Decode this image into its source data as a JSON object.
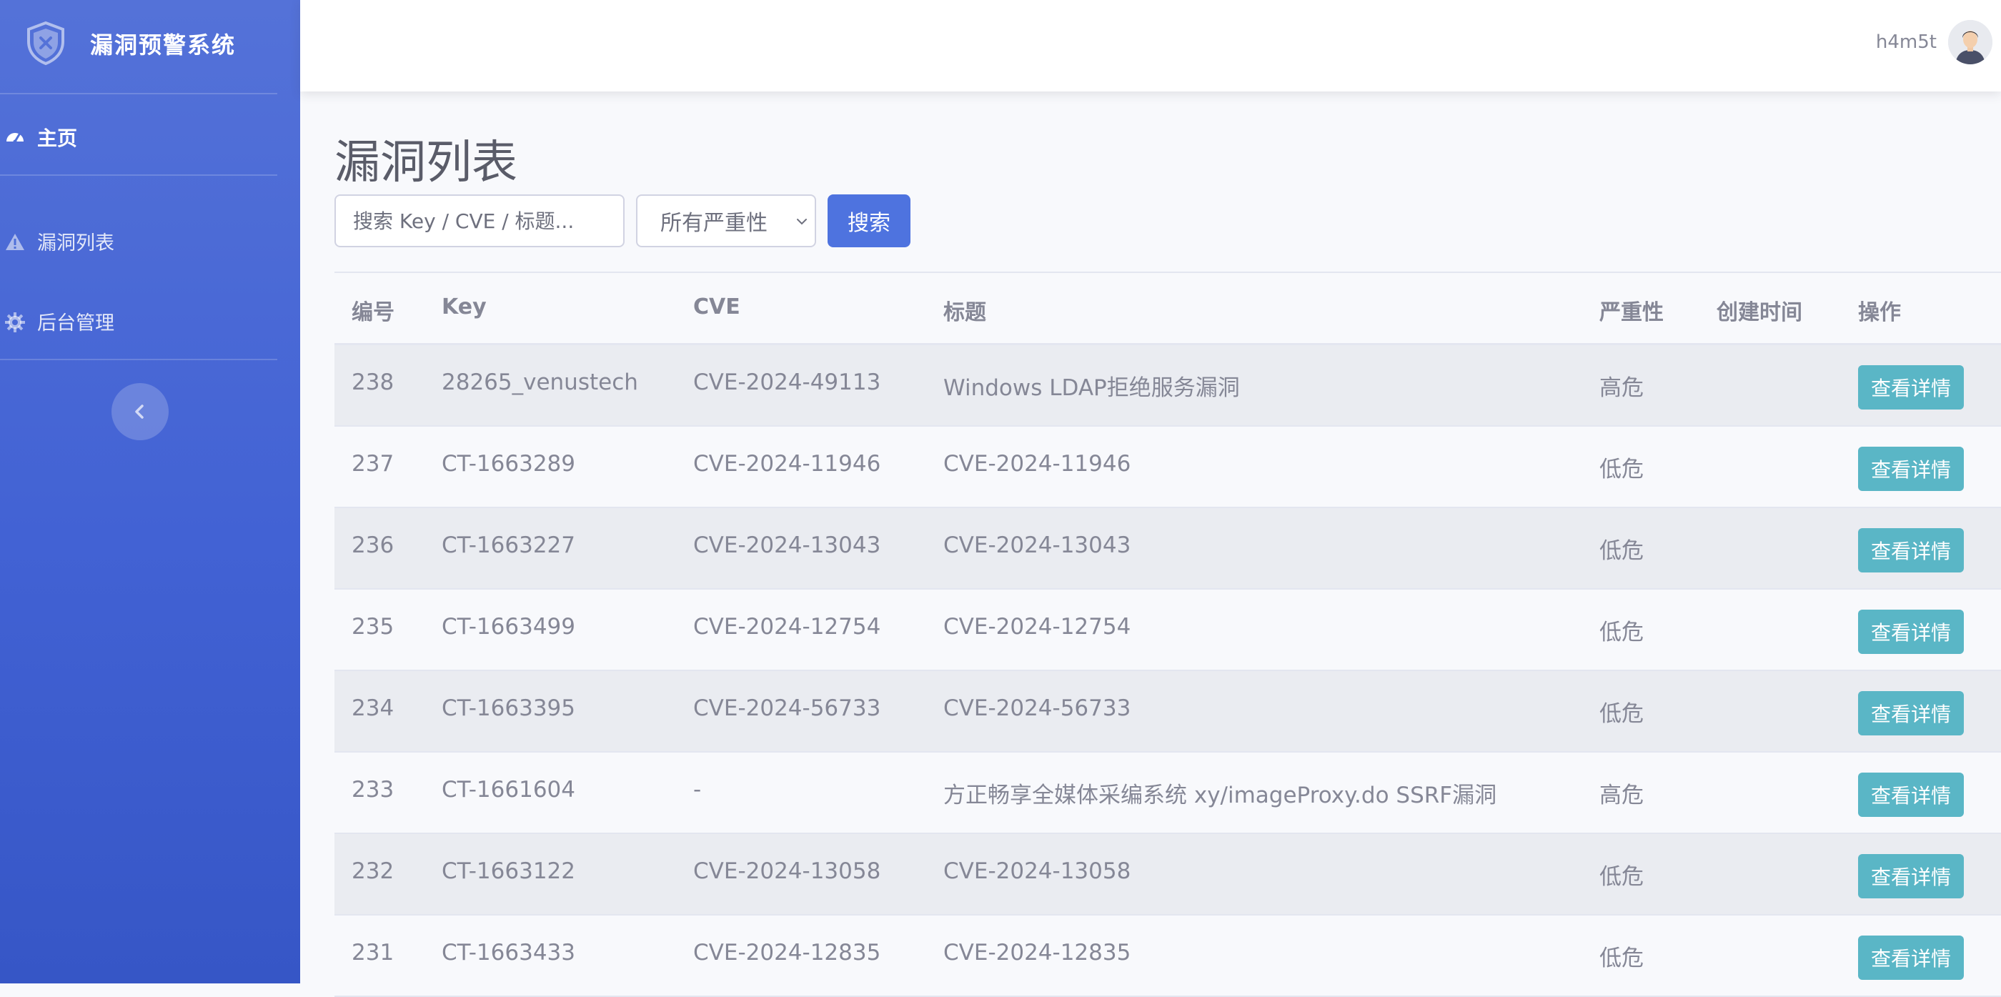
{
  "sidebar": {
    "brand": "漏洞预警系统",
    "items": [
      {
        "label": "主页",
        "icon": "dashboard-icon"
      },
      {
        "label": "漏洞列表",
        "icon": "warning-icon"
      },
      {
        "label": "后台管理",
        "icon": "gear-icon"
      }
    ],
    "collapse_icon": "chevron-left-icon"
  },
  "topbar": {
    "username": "h4m5t",
    "avatar_icon": "user-avatar"
  },
  "page": {
    "title": "漏洞列表"
  },
  "search": {
    "placeholder": "搜索 Key / CVE / 标题...",
    "severity_selected": "所有严重性",
    "button_label": "搜索"
  },
  "table": {
    "headers": [
      "编号",
      "Key",
      "CVE",
      "标题",
      "严重性",
      "创建时间",
      "操作"
    ],
    "rows": [
      {
        "id": "238",
        "key": "28265_venustech",
        "cve": "CVE-2024-49113",
        "title": "Windows LDAP拒绝服务漏洞",
        "severity": "高危",
        "created": "",
        "action": "查看详情"
      },
      {
        "id": "237",
        "key": "CT-1663289",
        "cve": "CVE-2024-11946",
        "title": "CVE-2024-11946",
        "severity": "低危",
        "created": "",
        "action": "查看详情"
      },
      {
        "id": "236",
        "key": "CT-1663227",
        "cve": "CVE-2024-13043",
        "title": "CVE-2024-13043",
        "severity": "低危",
        "created": "",
        "action": "查看详情"
      },
      {
        "id": "235",
        "key": "CT-1663499",
        "cve": "CVE-2024-12754",
        "title": "CVE-2024-12754",
        "severity": "低危",
        "created": "",
        "action": "查看详情"
      },
      {
        "id": "234",
        "key": "CT-1663395",
        "cve": "CVE-2024-56733",
        "title": "CVE-2024-56733",
        "severity": "低危",
        "created": "",
        "action": "查看详情"
      },
      {
        "id": "233",
        "key": "CT-1661604",
        "cve": "-",
        "title": "方正畅享全媒体采编系统 xy/imageProxy.do SSRF漏洞",
        "severity": "高危",
        "created": "",
        "action": "查看详情"
      },
      {
        "id": "232",
        "key": "CT-1663122",
        "cve": "CVE-2024-13058",
        "title": "CVE-2024-13058",
        "severity": "低危",
        "created": "",
        "action": "查看详情"
      },
      {
        "id": "231",
        "key": "CT-1663433",
        "cve": "CVE-2024-12835",
        "title": "CVE-2024-12835",
        "severity": "低危",
        "created": "",
        "action": "查看详情"
      }
    ]
  },
  "colors": {
    "sidebar": "#4e73df",
    "primary": "#4e73df",
    "info_button": "#5ab6c6",
    "text": "#858796"
  }
}
